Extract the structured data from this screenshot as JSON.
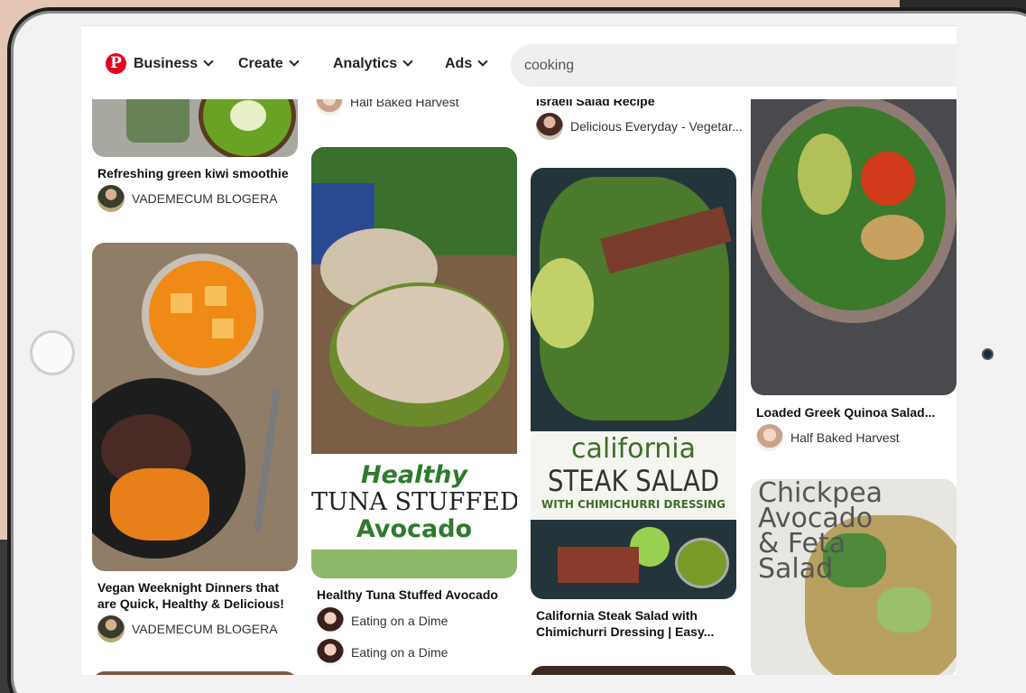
{
  "nav": {
    "items": [
      {
        "label": "Business"
      },
      {
        "label": "Create"
      },
      {
        "label": "Analytics"
      },
      {
        "label": "Ads"
      }
    ]
  },
  "search": {
    "value": "cooking"
  },
  "pins": {
    "kiwi": {
      "title": "Refreshing green kiwi smoothie",
      "author": "VADEMECUM BLOGERA"
    },
    "vegan": {
      "title_line1": "Vegan Weeknight Dinners that",
      "title_line2": "are Quick, Healthy & Delicious!",
      "author": "VADEMECUM BLOGERA"
    },
    "top_col2": {
      "author": "Half Baked Harvest"
    },
    "tuna": {
      "title": "Healthy Tuna Stuffed Avocado",
      "author1": "Eating on a Dime",
      "author2": "Eating on a Dime",
      "img_line1": "Healthy",
      "img_line2": "TUNA STUFFED",
      "img_line3": "Avocado"
    },
    "israeli": {
      "title": "Israeli Salad Recipe",
      "author": "Delicious Everyday - Vegetar..."
    },
    "steak": {
      "title_line1": "California Steak Salad with",
      "title_line2": "Chimichurri Dressing | Easy...",
      "img_line1": "california",
      "img_line2": "STEAK SALAD",
      "img_line3": "WITH CHIMICHURRI DRESSING"
    },
    "quinoa": {
      "title": "Loaded Greek Quinoa Salad...",
      "author": "Half Baked Harvest"
    },
    "chickpea": {
      "img_line1": "Chickpea",
      "img_line2": "Avocado",
      "img_line3": "& Feta",
      "img_line4": "Salad"
    }
  }
}
